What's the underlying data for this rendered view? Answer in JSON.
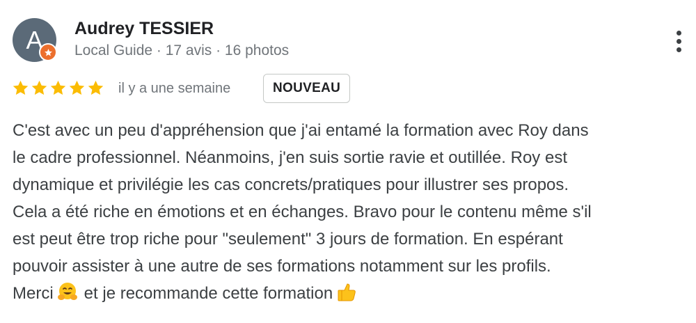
{
  "author": {
    "initial": "A",
    "name": "Audrey TESSIER",
    "meta": "Local Guide · 17 avis · 16 photos",
    "avatar_color": "#5b6a78",
    "badge_color": "#ec6f2d",
    "badge_icon": "local-guide-star-icon"
  },
  "rating": {
    "stars": 5,
    "max": 5,
    "star_color": "#fbbc04",
    "date": "il y a une semaine",
    "badge": "NOUVEAU"
  },
  "menu": {
    "icon": "more-vertical-icon"
  },
  "review": {
    "lines": [
      "C'est avec un peu d'appréhension que j'ai entamé la formation avec Roy dans",
      "le cadre professionnel. Néanmoins, j'en suis sortie ravie et outillée. Roy est",
      "dynamique et privilégie les cas concrets/pratiques pour illustrer ses propos.",
      "Cela a été riche en émotions et en échanges. Bravo pour le contenu même s'il",
      "est peut être trop riche pour \"seulement\" 3 jours de formation. En espérant",
      "pouvoir assister à une autre de ses formations notamment sur les profils."
    ],
    "last_line_start": "Merci",
    "last_line_middle": "et je recommande cette formation",
    "emoji_1": "hugging-face-emoji",
    "emoji_2": "thumbs-up-emoji"
  }
}
